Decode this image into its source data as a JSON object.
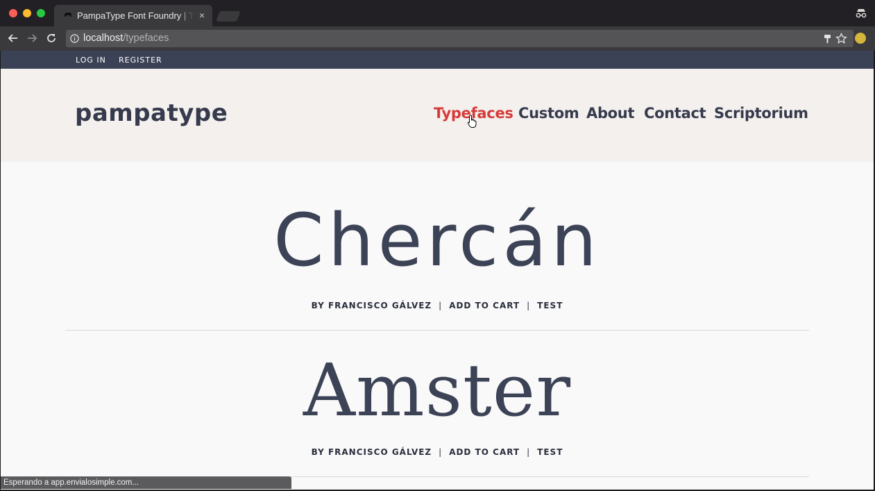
{
  "browser": {
    "tab_title": "PampaType Font Foundry | Ty",
    "tab_close": "×",
    "url_host": "localhost",
    "url_path": "/typefaces",
    "status_text": "Esperando a app.envialosimple.com..."
  },
  "topbar": {
    "login": "LOG IN",
    "register": "REGISTER"
  },
  "header": {
    "logo": "pampatype",
    "nav": [
      "Typefaces",
      "Custom",
      "About",
      "Contact",
      "Scriptorium"
    ],
    "active_nav": "Typefaces"
  },
  "families": [
    {
      "name": "Chercán",
      "author": "BY FRANCISCO GÁLVEZ",
      "cart": "ADD TO CART",
      "test": "TEST"
    },
    {
      "name": "Amster",
      "author": "BY FRANCISCO GÁLVEZ",
      "cart": "ADD TO CART",
      "test": "TEST"
    }
  ],
  "colors": {
    "accent": "#d83a3a",
    "ink": "#363a4d",
    "topbar": "#3c4256",
    "header_bg": "#f3f0ed"
  }
}
